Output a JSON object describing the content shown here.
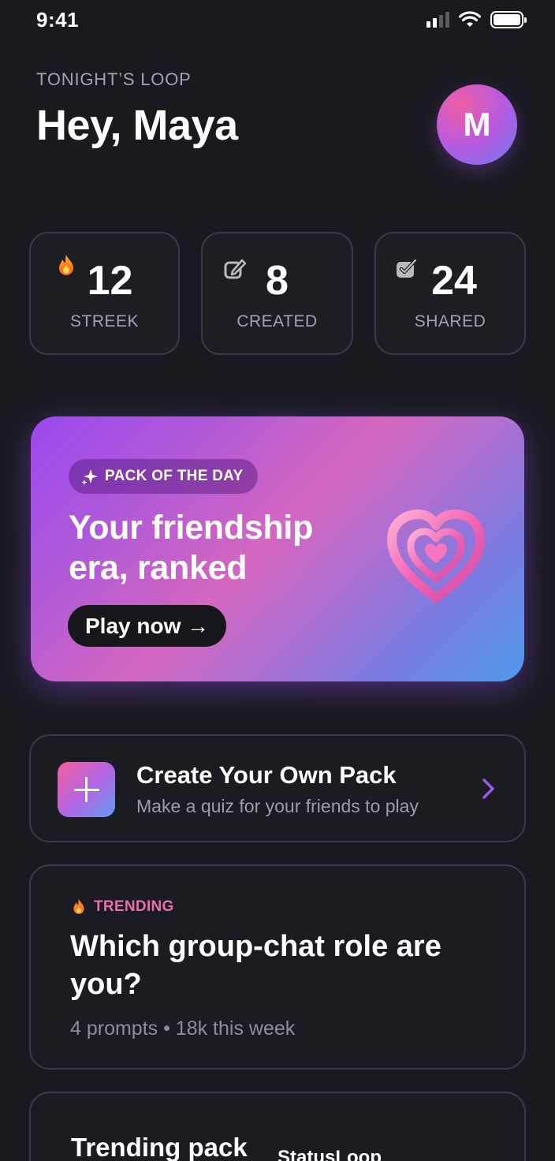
{
  "status_bar": {
    "time": "9:41"
  },
  "header": {
    "eyebrow": "TONIGHT’S LOOP",
    "greeting": "Hey, Maya",
    "avatar_initial": "M"
  },
  "stats": [
    {
      "icon": "flame-icon",
      "value": "12",
      "label": "STREEK"
    },
    {
      "icon": "edit-icon",
      "value": "8",
      "label": "CREATED"
    },
    {
      "icon": "share-check-icon",
      "value": "24",
      "label": "SHARED"
    }
  ],
  "hero": {
    "badge": "PACK OF THE DAY",
    "title": "Your friendship era, ranked",
    "cta": "Play now →",
    "icon": "heart-icon"
  },
  "create_pack": {
    "title": "Create Your Own Pack",
    "subtitle": "Make a quiz for your friends to play"
  },
  "trending": {
    "tag": "TRENDING",
    "title": "Which group-chat role are you?",
    "meta": "4 prompts • 18k this week"
  },
  "bottom_card": {
    "title": "Trending pack",
    "side_label": "StatusLoop"
  },
  "colors": {
    "background": "#191a1f",
    "card_border": "#3a3b42",
    "trending_accent": "#e96fa8",
    "hero_start": "#9a48ee",
    "hero_end": "#4f9aea"
  }
}
